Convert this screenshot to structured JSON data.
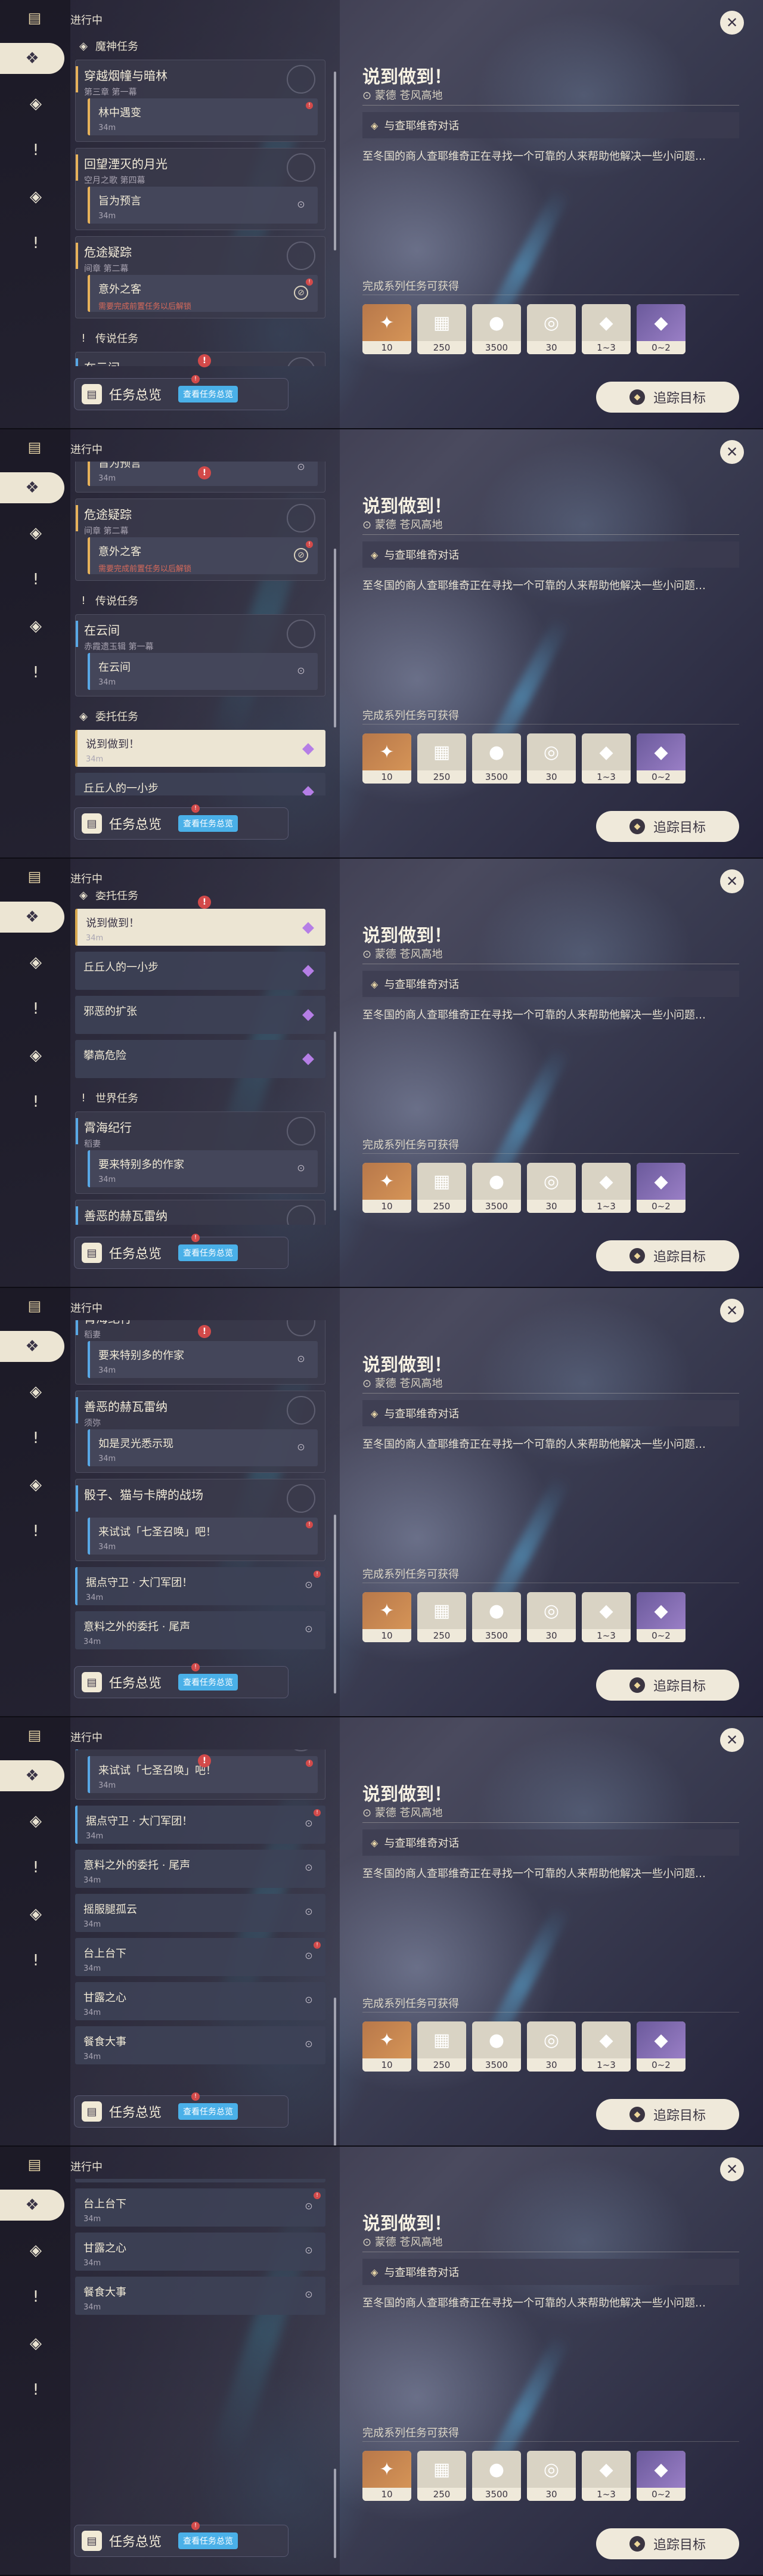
{
  "rail": {
    "top_icon": "quest-book-icon",
    "buttons": [
      "all-quests-icon",
      "archon-quest-icon",
      "story-quest-icon",
      "commission-icon",
      "world-quest-icon"
    ]
  },
  "list": {
    "header": "进行中",
    "overview_label": "任务总览",
    "overview_tag": "查看任务总览",
    "alert_mark": "!"
  },
  "sections": {
    "archon": "魔神任务",
    "legend": "传说任务",
    "commission": "委托任务",
    "world": "世界任务"
  },
  "quests": {
    "q1_title": "穿越烟幢与暗林",
    "q1_sub": "第三章 第一幕",
    "q1_child": "林中遇变",
    "q1_child_sub": "34m",
    "q2_title": "回望湮灭的月光",
    "q2_sub": "空月之歌 第四幕",
    "q2_child": "旨为预言",
    "q2_child_sub": "34m",
    "q3_title": "危途疑踪",
    "q3_sub": "间章 第二幕",
    "q3_child": "意外之客",
    "q3_child_sub": "需要完成前置任务以后解锁",
    "q4_title": "在云间",
    "q4_sub": "赤霞遗玉辑 第一幕",
    "q4_child": "在云间",
    "q4_child_sub": "34m",
    "c1": "说到做到！",
    "c1_sub": "34m",
    "c2": "丘丘人的一小步",
    "c3": "邪恶的扩张",
    "c4": "攀高危险",
    "w1_title": "霄海纪行",
    "w1_sub": "稻妻",
    "w1_child": "要来特别多的作家",
    "w1_child_sub": "34m",
    "w2_title": "善恶的赫瓦雷纳",
    "w2_sub": "须弥",
    "w2_child": "如是灵光悉示现",
    "w2_child_sub": "34m",
    "w3_title": "骰子、猫与卡牌的战场",
    "w3_child": "来试试「七圣召唤」吧！",
    "w3_child_sub": "34m",
    "p1": "据点守卫 · 大门军团！",
    "p1_sub": "34m",
    "p2": "意料之外的委托 · 尾声",
    "p2_sub": "34m",
    "p3": "摇服腿孤云",
    "p3_sub": "34m",
    "p4": "台上台下",
    "p4_sub": "34m",
    "p5": "甘露之心",
    "p5_sub": "34m",
    "p6": "餐食大事",
    "p6_sub": "34m"
  },
  "detail": {
    "title": "说到做到！",
    "location": "蒙德 苍风高地",
    "objective": "与查耶维奇对话",
    "description": "至冬国的商人查耶维奇正在寻找一个可靠的人来帮助他解决一些小问题…",
    "reward_label": "完成系列任务可获得",
    "rewards": [
      {
        "icon": "adventure-exp-icon",
        "count": "10",
        "style": "r-orange",
        "glyph": "✦"
      },
      {
        "icon": "mora-note-icon",
        "count": "250",
        "style": "",
        "glyph": "▦"
      },
      {
        "icon": "mora-coin-icon",
        "count": "3500",
        "style": "",
        "glyph": "●"
      },
      {
        "icon": "friendship-icon",
        "count": "30",
        "style": "",
        "glyph": "◎"
      },
      {
        "icon": "crystal-pink-icon",
        "count": "1~3",
        "style": "",
        "glyph": "◆"
      },
      {
        "icon": "crystal-purple-icon",
        "count": "0~2",
        "style": "r-purple",
        "glyph": "◆"
      }
    ],
    "track_label": "追踪目标"
  },
  "colors": {
    "archon": "#e7b25a",
    "world": "#58a8e6",
    "alert": "#d24a4a"
  }
}
